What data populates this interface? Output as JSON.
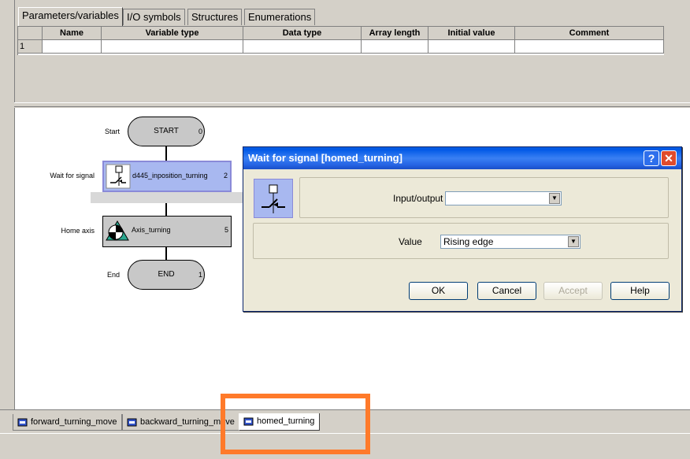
{
  "top_tabs": [
    "Parameters/variables",
    "I/O symbols",
    "Structures",
    "Enumerations"
  ],
  "grid": {
    "columns": [
      "",
      "Name",
      "Variable type",
      "Data type",
      "Array length",
      "Initial value",
      "Comment"
    ],
    "rows": [
      [
        "1",
        "",
        "",
        "",
        "",
        "",
        ""
      ]
    ]
  },
  "flowchart": {
    "start": {
      "label": "Start",
      "text": "START",
      "num": "0"
    },
    "wait": {
      "label": "Wait for signal",
      "text": "d445_inposition_turning",
      "num": "2"
    },
    "home": {
      "label": "Home axis",
      "text": "Axis_turning",
      "num": "5"
    },
    "end": {
      "label": "End",
      "text": "END",
      "num": "1"
    }
  },
  "dialog": {
    "title": "Wait for signal [homed_turning]",
    "help_glyph": "?",
    "close_glyph": "✕",
    "io_label": "Input/output",
    "io_value": "",
    "value_label": "Value",
    "value_selected": "Rising edge",
    "buttons": {
      "ok": "OK",
      "cancel": "Cancel",
      "accept": "Accept",
      "help": "Help"
    }
  },
  "bottom_tabs": [
    {
      "label": "forward_turning_move",
      "active": false
    },
    {
      "label": "backward_turning_move",
      "active": false
    },
    {
      "label": "homed_turning",
      "active": true
    }
  ],
  "colors": {
    "highlight": "#ff7a2a",
    "selected_step": "#a8b8f0"
  }
}
